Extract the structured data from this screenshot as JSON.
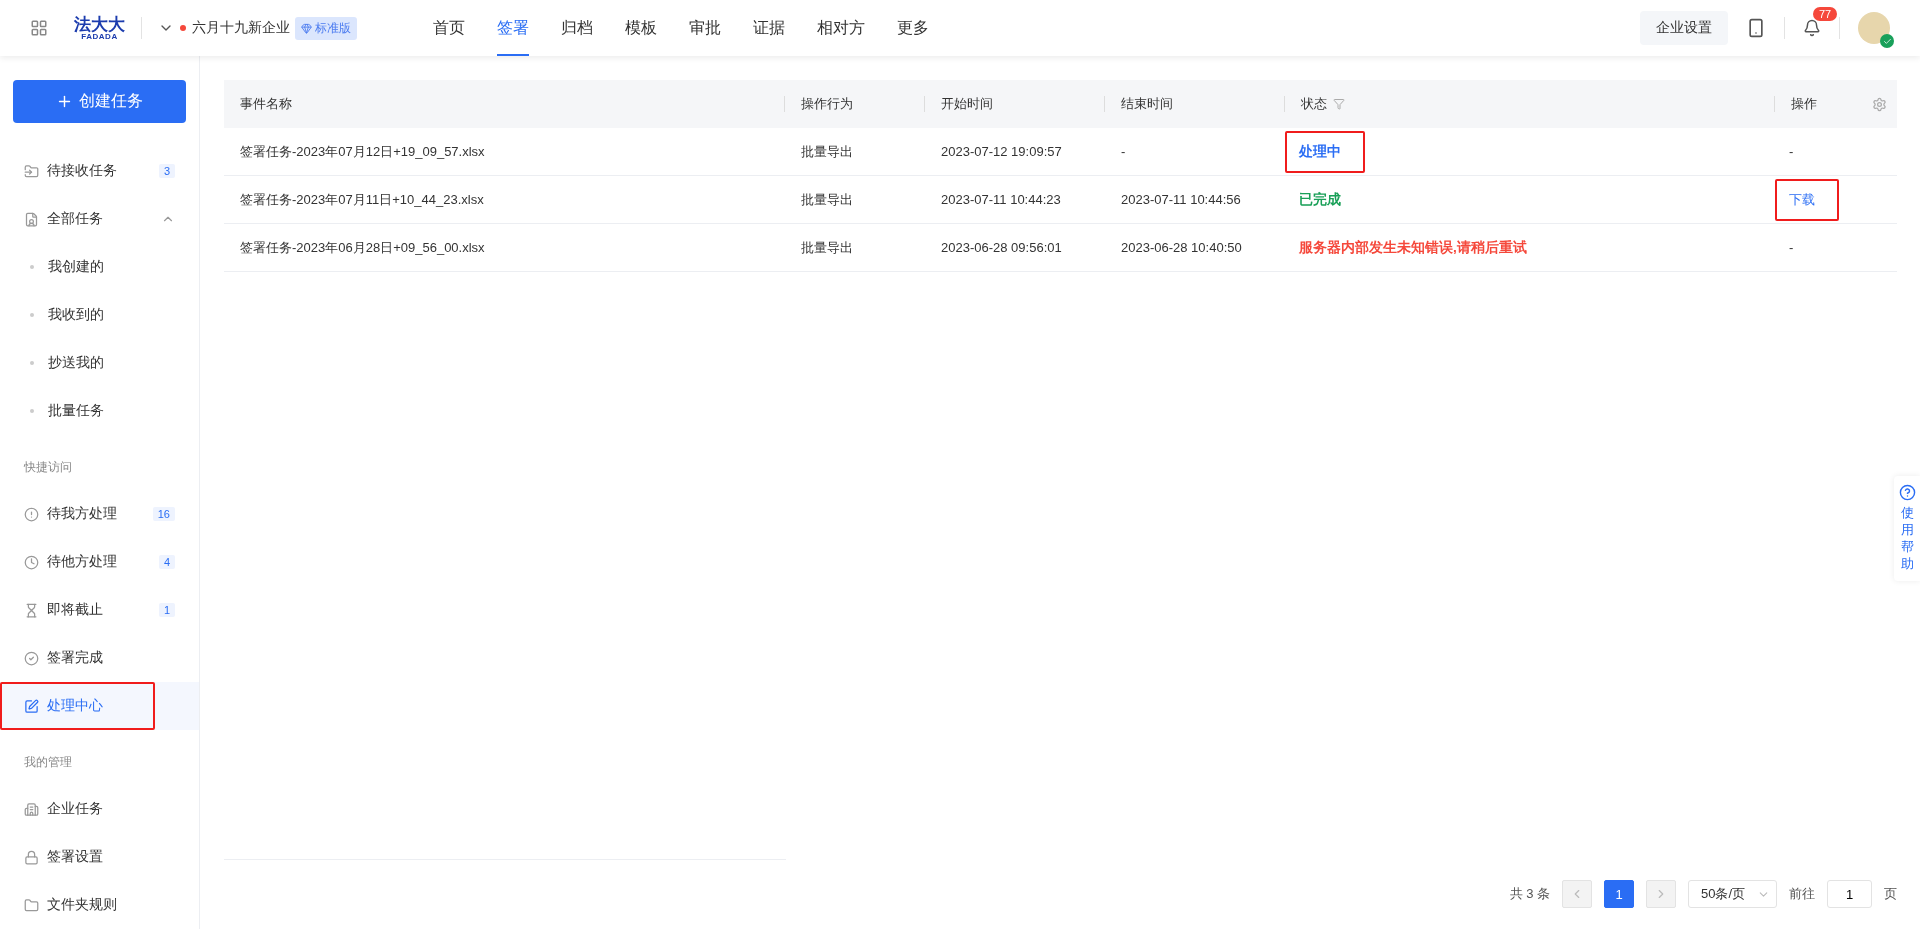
{
  "top_bar": {
    "logo": {
      "name": "法大大",
      "sub": "FADADA"
    },
    "company": {
      "name": "六月十九新企业",
      "edition": "标准版"
    },
    "nav": [
      {
        "label": "首页",
        "selected": false
      },
      {
        "label": "签署",
        "selected": true
      },
      {
        "label": "归档",
        "selected": false
      },
      {
        "label": "模板",
        "selected": false
      },
      {
        "label": "审批",
        "selected": false
      },
      {
        "label": "证据",
        "selected": false
      },
      {
        "label": "相对方",
        "selected": false
      },
      {
        "label": "更多",
        "selected": false
      }
    ],
    "settings_button": "企业设置",
    "notification_count": "77"
  },
  "sidebar": {
    "create_button": "创建任务",
    "sections": [
      {
        "items": [
          {
            "label": "待接收任务",
            "badge": "3",
            "selected": false,
            "highlighted": false
          },
          {
            "label": "全部任务",
            "expanded": true,
            "selected": false,
            "highlighted": false,
            "children": [
              {
                "label": "我创建的",
                "selected": false
              },
              {
                "label": "我收到的",
                "selected": false
              },
              {
                "label": "抄送我的",
                "selected": false
              },
              {
                "label": "批量任务",
                "selected": false
              }
            ]
          }
        ]
      },
      {
        "title": "快捷访问",
        "items": [
          {
            "label": "待我方处理",
            "badge": "16",
            "selected": false,
            "highlighted": false
          },
          {
            "label": "待他方处理",
            "badge": "4",
            "selected": false,
            "highlighted": false
          },
          {
            "label": "即将截止",
            "badge": "1",
            "selected": false,
            "highlighted": false
          },
          {
            "label": "签署完成",
            "selected": false,
            "highlighted": false
          },
          {
            "label": "处理中心",
            "selected": true,
            "highlighted": true
          }
        ]
      },
      {
        "title": "我的管理",
        "items": [
          {
            "label": "企业任务",
            "selected": false,
            "highlighted": false
          },
          {
            "label": "签署设置",
            "selected": false,
            "highlighted": false
          },
          {
            "label": "文件夹规则",
            "selected": false,
            "highlighted": false
          }
        ]
      }
    ]
  },
  "table": {
    "columns": [
      "事件名称",
      "操作行为",
      "开始时间",
      "结束时间",
      "状态",
      "操作"
    ],
    "rows": [
      {
        "name": "签署任务-2023年07月12日+19_09_57.xlsx",
        "action": "批量导出",
        "start": "2023-07-12 19:09:57",
        "end": "-",
        "status": "处理中",
        "color": "#2a6df4",
        "status_highlighted": true,
        "operation": "-",
        "kind": "text",
        "operation_highlighted": false
      },
      {
        "name": "签署任务-2023年07月11日+10_44_23.xlsx",
        "action": "批量导出",
        "start": "2023-07-11 10:44:23",
        "end": "2023-07-11 10:44:56",
        "status": "已完成",
        "color": "#1aa058",
        "status_highlighted": false,
        "operation": "下载",
        "kind": "link",
        "operation_highlighted": true
      },
      {
        "name": "签署任务-2023年06月28日+09_56_00.xlsx",
        "action": "批量导出",
        "start": "2023-06-28 09:56:01",
        "end": "2023-06-28 10:40:50",
        "status": "服务器内部发生未知错误,请稍后重试",
        "color": "#f5483b",
        "status_highlighted": false,
        "operation": "-",
        "kind": "text",
        "operation_highlighted": false
      }
    ]
  },
  "pagination": {
    "total": "共 3 条",
    "current_page": "1",
    "page_size": "50条/页",
    "goto_label": "前往",
    "goto_value": "1",
    "page_unit": "页"
  },
  "help": {
    "label": "使用帮助"
  }
}
